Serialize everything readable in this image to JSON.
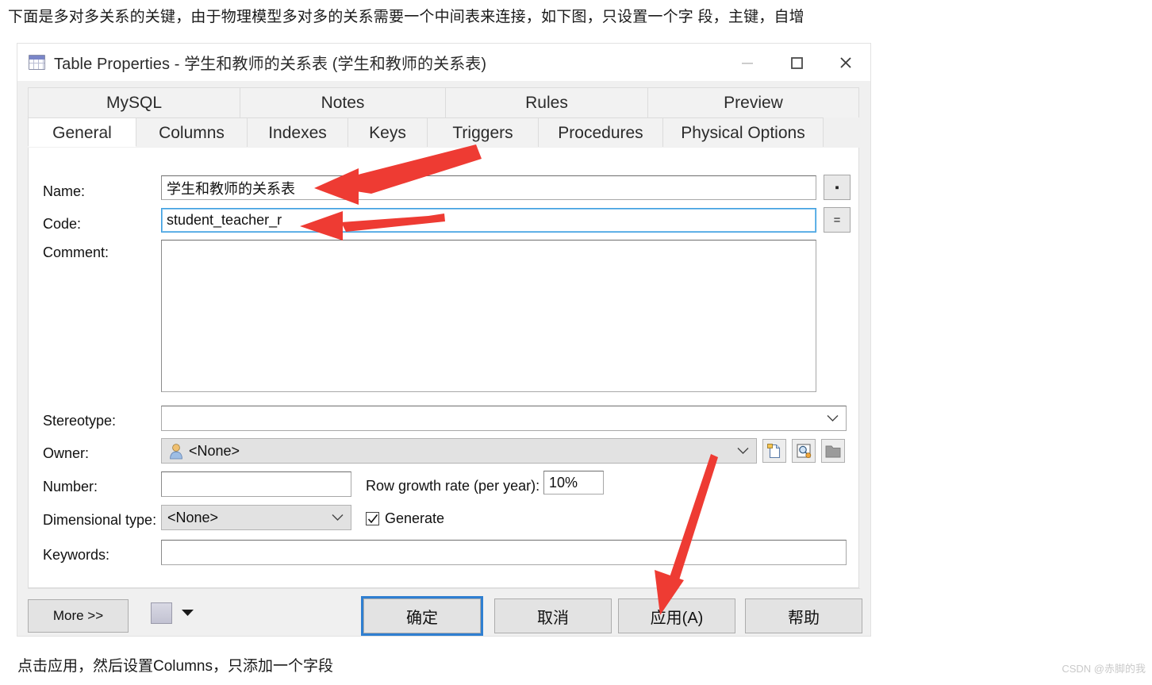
{
  "page": {
    "intro_text": "下面是多对多关系的关键，由于物理模型多对多的关系需要一个中间表来连接，如下图，只设置一个字 段，主键，自增",
    "caption_text": "点击应用，然后设置Columns，只添加一个字段",
    "watermark": "CSDN @赤脚的我"
  },
  "colors": {
    "accent_blue": "#2f7fd1",
    "arrow_red": "#ee3b33",
    "dialog_bg": "#f0f0f0",
    "field_focus": "#3f9fe0"
  },
  "dialog": {
    "title": "Table Properties - 学生和教师的关系表 (学生和教师的关系表)",
    "icon": "table-icon",
    "window_controls": [
      {
        "name": "minimize-button",
        "glyph": "minimize-icon"
      },
      {
        "name": "maximize-button",
        "glyph": "maximize-icon"
      },
      {
        "name": "close-button",
        "glyph": "close-icon"
      }
    ],
    "tabs_row1": [
      {
        "label": "MySQL",
        "active": false
      },
      {
        "label": "Notes",
        "active": false
      },
      {
        "label": "Rules",
        "active": false
      },
      {
        "label": "Preview",
        "active": false
      }
    ],
    "tabs_row2": [
      {
        "label": "General",
        "active": true
      },
      {
        "label": "Columns",
        "active": false
      },
      {
        "label": "Indexes",
        "active": false
      },
      {
        "label": "Keys",
        "active": false
      },
      {
        "label": "Triggers",
        "active": false
      },
      {
        "label": "Procedures",
        "active": false
      },
      {
        "label": "Physical Options",
        "active": false
      }
    ],
    "general": {
      "name_label": "Name:",
      "name_value": "学生和教师的关系表",
      "name_button_glyph": "▪",
      "code_label": "Code:",
      "code_value": "student_teacher_r",
      "code_button_glyph": "=",
      "comment_label": "Comment:",
      "comment_value": "",
      "stereotype_label": "Stereotype:",
      "stereotype_value": "",
      "owner_label": "Owner:",
      "owner_value": "<None>",
      "owner_buttons": [
        "new-object-icon",
        "browse-object-icon",
        "folder-icon"
      ],
      "number_label": "Number:",
      "number_value": "",
      "row_growth_label": "Row growth rate (per year):",
      "row_growth_value": "10%",
      "dimensional_label": "Dimensional type:",
      "dimensional_value": "<None>",
      "generate_label": "Generate",
      "generate_checked": true,
      "keywords_label": "Keywords:",
      "keywords_value": ""
    },
    "footer": {
      "more_label": "More >>",
      "print_icon": "print-icon",
      "print_dropdown": "chevron-down-icon",
      "ok_label": "确定",
      "cancel_label": "取消",
      "apply_label": "应用(A)",
      "help_label": "帮助"
    }
  },
  "annotations": [
    {
      "name": "arrow-to-name-field",
      "target": "name_value"
    },
    {
      "name": "arrow-to-code-field",
      "target": "code_value"
    },
    {
      "name": "arrow-to-apply-button",
      "target": "apply_label"
    }
  ]
}
